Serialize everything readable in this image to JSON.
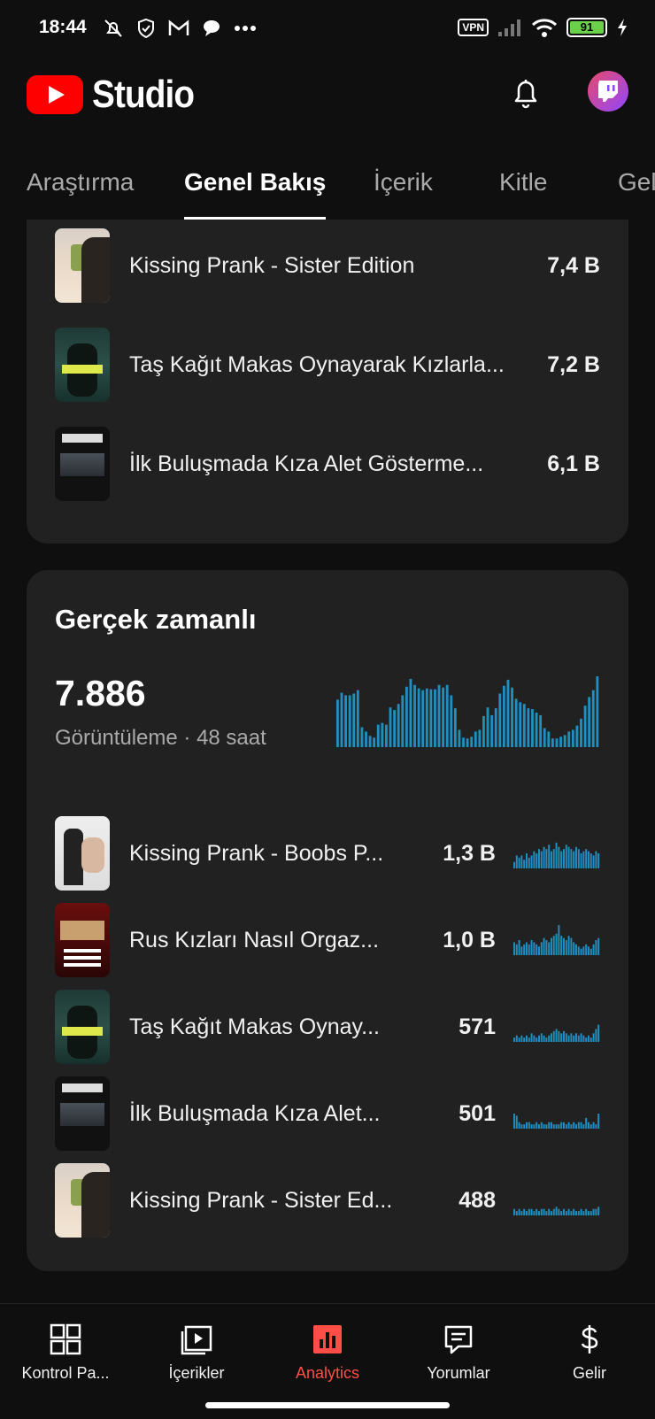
{
  "status_bar": {
    "time": "18:44",
    "vpn": "VPN",
    "battery": "91",
    "icons": [
      "mute-bell-icon",
      "shield-icon",
      "gmail-icon",
      "chat-icon",
      "more-icon",
      "signal-icon",
      "wifi-icon",
      "charging-icon"
    ]
  },
  "header": {
    "logo_text": "Studio",
    "bell_icon": "notification-bell-icon",
    "avatar_icon": "twitch-avatar-icon"
  },
  "tabs": [
    {
      "label": "Araştırma",
      "active": false
    },
    {
      "label": "Genel Bakış",
      "active": true
    },
    {
      "label": "İçerik",
      "active": false
    },
    {
      "label": "Kitle",
      "active": false
    },
    {
      "label": "Gel",
      "active": false
    }
  ],
  "top_videos": [
    {
      "title": "Kissing Prank - Sister Edition",
      "value": "7,4 B"
    },
    {
      "title": "Taş Kağıt Makas Oynayarak Kızlarla...",
      "value": "7,2 B"
    },
    {
      "title": "İlk Buluşmada Kıza Alet Gösterme...",
      "value": "6,1 B"
    }
  ],
  "realtime": {
    "title": "Gerçek zamanlı",
    "views": "7.886",
    "subtitle": "Görüntüleme · 48 saat",
    "accent": "#1f8fbf",
    "chart_bars": [
      55,
      63,
      60,
      60,
      62,
      66,
      23,
      18,
      13,
      11,
      26,
      28,
      26,
      46,
      43,
      50,
      60,
      70,
      79,
      72,
      68,
      66,
      68,
      67,
      67,
      72,
      69,
      72,
      60,
      45,
      20,
      11,
      10,
      12,
      18,
      20,
      36,
      46,
      37,
      45,
      62,
      71,
      78,
      69,
      56,
      52,
      50,
      45,
      44,
      40,
      37,
      22,
      18,
      10,
      10,
      12,
      14,
      18,
      20,
      25,
      33,
      48,
      58,
      66,
      82
    ]
  },
  "realtime_videos": [
    {
      "title": "Kissing Prank - Boobs P...",
      "value": "1,3 B",
      "spark": [
        3,
        6,
        5,
        6,
        4,
        7,
        5,
        6,
        8,
        7,
        9,
        8,
        10,
        9,
        11,
        8,
        9,
        12,
        10,
        8,
        9,
        11,
        10,
        9,
        8,
        10,
        9,
        7,
        8,
        9,
        8,
        7,
        6,
        8,
        7
      ]
    },
    {
      "title": "Rus Kızları Nasıl Orgaz...",
      "value": "1,0 B",
      "spark": [
        6,
        5,
        7,
        4,
        5,
        6,
        5,
        7,
        6,
        5,
        4,
        6,
        8,
        7,
        6,
        8,
        9,
        10,
        14,
        9,
        8,
        7,
        9,
        8,
        6,
        5,
        4,
        3,
        4,
        5,
        4,
        3,
        5,
        7,
        8
      ]
    },
    {
      "title": "Taş Kağıt Makas Oynay...",
      "value": "571",
      "spark": [
        2,
        3,
        2,
        3,
        2,
        3,
        2,
        4,
        3,
        2,
        3,
        4,
        3,
        2,
        3,
        4,
        5,
        6,
        5,
        4,
        5,
        4,
        3,
        4,
        3,
        4,
        3,
        4,
        3,
        2,
        3,
        2,
        4,
        6,
        8
      ]
    },
    {
      "title": "İlk Buluşmada Kıza Alet...",
      "value": "501",
      "spark": [
        7,
        6,
        3,
        2,
        2,
        3,
        3,
        2,
        2,
        3,
        2,
        3,
        2,
        2,
        3,
        3,
        2,
        2,
        2,
        3,
        3,
        2,
        3,
        2,
        3,
        2,
        3,
        3,
        2,
        5,
        3,
        2,
        3,
        2,
        7
      ]
    },
    {
      "title": "Kissing Prank - Sister Ed...",
      "value": "488",
      "spark": [
        3,
        2,
        3,
        2,
        3,
        2,
        3,
        3,
        2,
        3,
        2,
        3,
        3,
        2,
        3,
        2,
        3,
        4,
        3,
        2,
        3,
        2,
        3,
        2,
        3,
        2,
        2,
        3,
        2,
        3,
        2,
        2,
        3,
        3,
        4
      ]
    }
  ],
  "bottom_nav": [
    {
      "label": "Kontrol Pa...",
      "icon": "dashboard-icon",
      "active": false
    },
    {
      "label": "İçerikler",
      "icon": "content-icon",
      "active": false
    },
    {
      "label": "Analytics",
      "icon": "analytics-icon",
      "active": true
    },
    {
      "label": "Yorumlar",
      "icon": "comments-icon",
      "active": false
    },
    {
      "label": "Gelir",
      "icon": "earn-icon",
      "active": false
    }
  ]
}
